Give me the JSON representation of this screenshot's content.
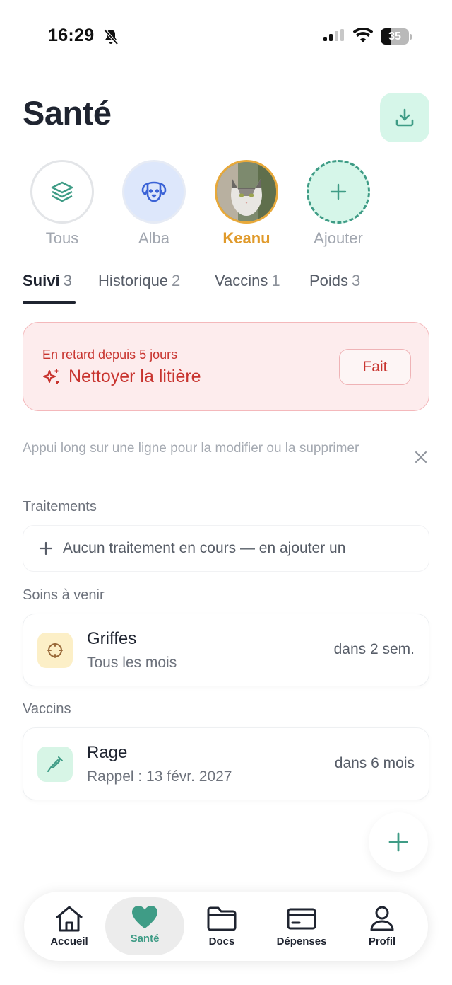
{
  "status_bar": {
    "time": "16:29",
    "battery": "35",
    "battery_level": 0.35
  },
  "header": {
    "title": "Santé"
  },
  "pets": [
    {
      "label": "Tous",
      "icon": "layers-icon"
    },
    {
      "label": "Alba",
      "icon": "dog-icon"
    },
    {
      "label": "Keanu",
      "icon": "cat-photo",
      "selected": true
    },
    {
      "label": "Ajouter",
      "icon": "plus-icon"
    }
  ],
  "tabs": [
    {
      "label": "Suivi",
      "count": "3",
      "active": true
    },
    {
      "label": "Historique",
      "count": "2"
    },
    {
      "label": "Vaccins",
      "count": "1"
    },
    {
      "label": "Poids",
      "count": "3"
    }
  ],
  "overdue": {
    "caption": "En retard depuis 5 jours",
    "title": "Nettoyer la litière",
    "action": "Fait"
  },
  "hint": {
    "text": "Appui long sur une ligne pour la modifier ou la supprimer"
  },
  "sections": {
    "treatments": {
      "label": "Traitements",
      "empty": "Aucun traitement en cours — en ajouter un"
    },
    "upcoming": {
      "label": "Soins à venir",
      "items": [
        {
          "name": "Griffes",
          "sub": "Tous les mois",
          "due": "dans 2 sem.",
          "icon": "crosshair-icon"
        }
      ]
    },
    "vaccines": {
      "label": "Vaccins",
      "items": [
        {
          "name": "Rage",
          "sub": "Rappel : 13 févr. 2027",
          "due": "dans 6 mois",
          "icon": "syringe-icon"
        }
      ]
    }
  },
  "nav": [
    {
      "label": "Accueil",
      "icon": "home-icon"
    },
    {
      "label": "Santé",
      "icon": "heart-icon",
      "active": true
    },
    {
      "label": "Docs",
      "icon": "folder-icon"
    },
    {
      "label": "Dépenses",
      "icon": "card-icon"
    },
    {
      "label": "Profil",
      "icon": "user-icon"
    }
  ],
  "colors": {
    "accent": "#3f9c86",
    "accent_bg": "#d6f6e9",
    "selected_pet": "#e8a93a",
    "danger": "#c8342f",
    "danger_bg": "#fdeced"
  }
}
